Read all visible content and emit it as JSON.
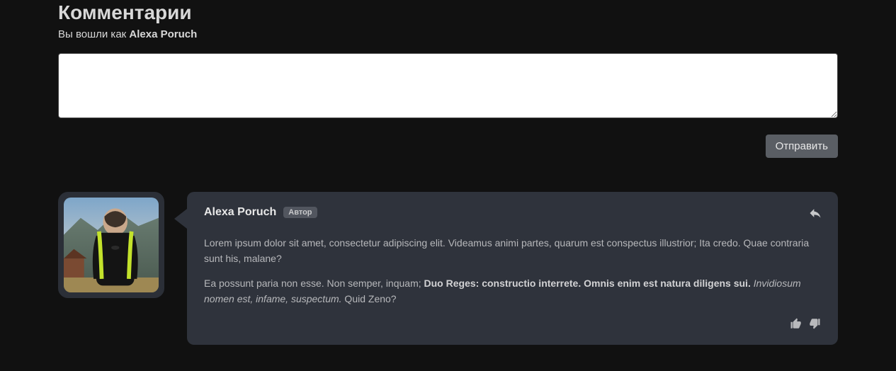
{
  "header": {
    "title": "Комментарии",
    "logged_in_prefix": "Вы вошли как ",
    "username": "Alexa Poruch"
  },
  "form": {
    "textarea_value": "",
    "submit_label": "Отправить"
  },
  "comments": [
    {
      "author": "Alexa Poruch",
      "badge": "Автор",
      "paragraphs": [
        {
          "pre": "Lorem ipsum dolor sit amet, consectetur adipiscing elit. Videamus animi partes, quarum est conspectus illustrior; Ita credo. Quae contraria sunt his, malane?",
          "strong": "",
          "em": "",
          "post": ""
        },
        {
          "pre": "Ea possunt paria non esse. Non semper, inquam; ",
          "strong": "Duo Reges: constructio interrete. Omnis enim est natura diligens sui.",
          "em": " Invidiosum nomen est, infame, suspectum.",
          "post": " Quid Zeno?"
        }
      ]
    }
  ]
}
